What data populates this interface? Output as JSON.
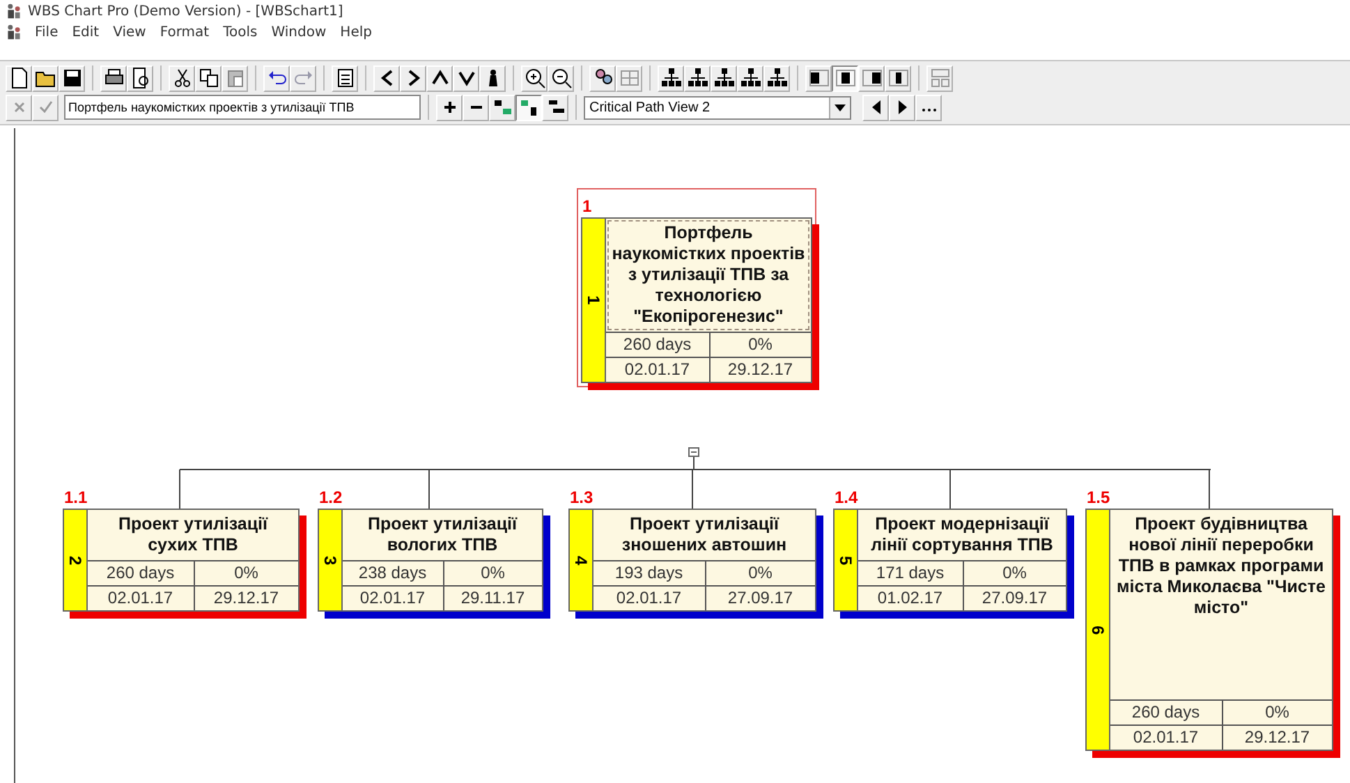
{
  "window": {
    "title": "WBS Chart Pro (Demo Version) - [WBSchart1]"
  },
  "menu": [
    "File",
    "Edit",
    "View",
    "Format",
    "Tools",
    "Window",
    "Help"
  ],
  "edit_bar": {
    "value": "Портфель наукомістких проектів з утилізації ТПВ"
  },
  "view_select": {
    "value": "Critical Path View 2"
  },
  "chart": {
    "wbs": "1",
    "number": "1",
    "title": "Портфель наукомістких проектів з утилізації ТПВ за технологією \"Екопірогенезис\"",
    "duration": "260 days",
    "complete": "0%",
    "start": "02.01.17",
    "finish": "29.12.17",
    "color": "#ee0000",
    "selected": true,
    "children": [
      {
        "wbs": "1.1",
        "number": "2",
        "title": "Проект утилізації сухих ТПВ",
        "duration": "260 days",
        "complete": "0%",
        "start": "02.01.17",
        "finish": "29.12.17",
        "color": "#ee0000",
        "selected": false
      },
      {
        "wbs": "1.2",
        "number": "3",
        "title": "Проект утилізації вологих ТПВ",
        "duration": "238 days",
        "complete": "0%",
        "start": "02.01.17",
        "finish": "29.11.17",
        "color": "#0000cc",
        "selected": false
      },
      {
        "wbs": "1.3",
        "number": "4",
        "title": "Проект утилізації зношених автошин",
        "duration": "193 days",
        "complete": "0%",
        "start": "02.01.17",
        "finish": "27.09.17",
        "color": "#0000cc",
        "selected": false
      },
      {
        "wbs": "1.4",
        "number": "5",
        "title": "Проект модернізації лінії сортування ТПВ",
        "duration": "171 days",
        "complete": "0%",
        "start": "01.02.17",
        "finish": "27.09.17",
        "color": "#0000cc",
        "selected": false
      },
      {
        "wbs": "1.5",
        "number": "6",
        "title": "Проект будівництва нової лінії переробки ТПВ в рамках програми міста Миколаєва \"Чисте місто\"",
        "duration": "260 days",
        "complete": "0%",
        "start": "02.01.17",
        "finish": "29.12.17",
        "color": "#ee0000",
        "selected": false
      }
    ]
  }
}
